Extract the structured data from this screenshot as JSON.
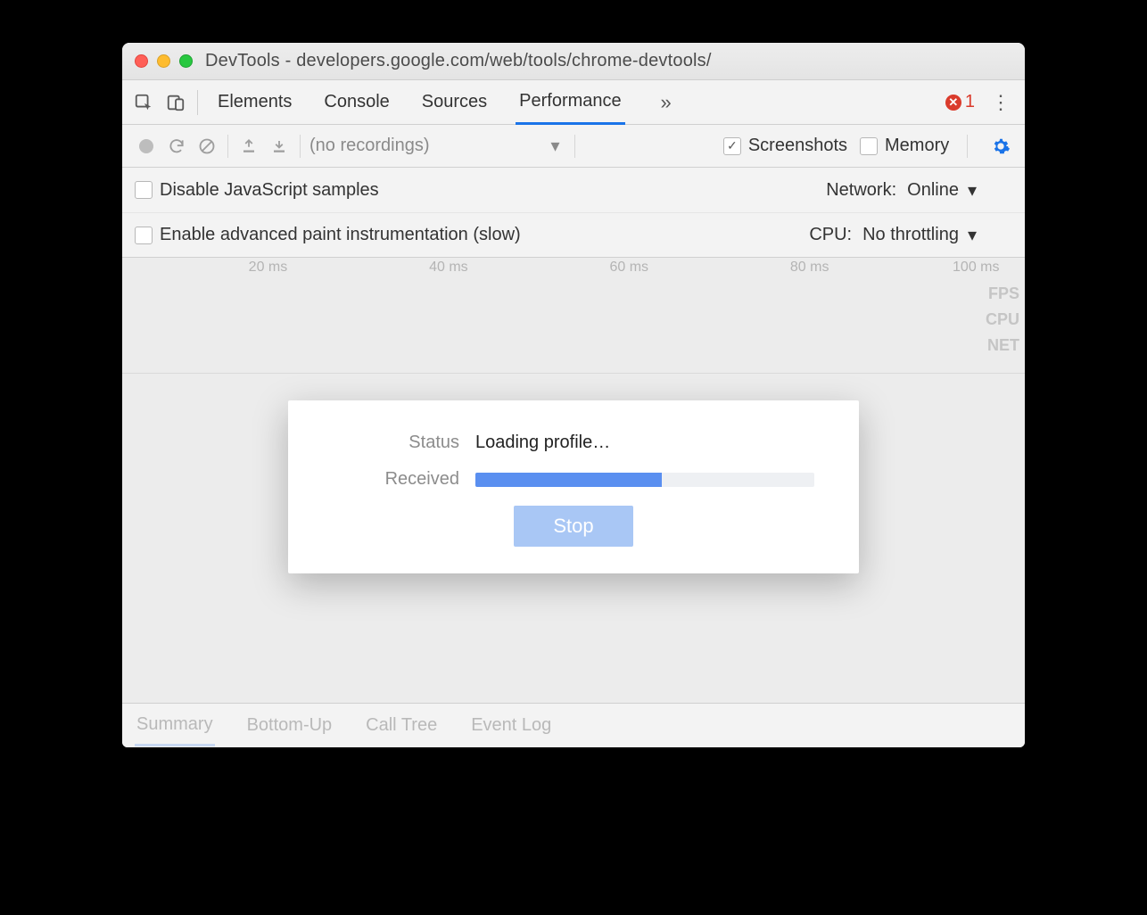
{
  "window": {
    "title": "DevTools - developers.google.com/web/tools/chrome-devtools/"
  },
  "tabs": {
    "items": [
      "Elements",
      "Console",
      "Sources",
      "Performance"
    ],
    "active": "Performance"
  },
  "errors": {
    "count": "1"
  },
  "toolbar": {
    "recordings_placeholder": "(no recordings)",
    "screenshots": {
      "label": "Screenshots",
      "checked": true
    },
    "memory": {
      "label": "Memory",
      "checked": false
    }
  },
  "options": {
    "disable_js_samples": {
      "label": "Disable JavaScript samples",
      "checked": false
    },
    "enable_paint_instr": {
      "label": "Enable advanced paint instrumentation (slow)",
      "checked": false
    },
    "network": {
      "label": "Network:",
      "value": "Online"
    },
    "cpu": {
      "label": "CPU:",
      "value": "No throttling"
    }
  },
  "timeline": {
    "ticks": [
      "20 ms",
      "40 ms",
      "60 ms",
      "80 ms",
      "100 ms"
    ],
    "lanes": [
      "FPS",
      "CPU",
      "NET"
    ]
  },
  "modal": {
    "status_label": "Status",
    "status_value": "Loading profile…",
    "received_label": "Received",
    "progress_percent": 55,
    "stop_label": "Stop"
  },
  "footer": {
    "tabs": [
      "Summary",
      "Bottom-Up",
      "Call Tree",
      "Event Log"
    ],
    "active": "Summary"
  }
}
